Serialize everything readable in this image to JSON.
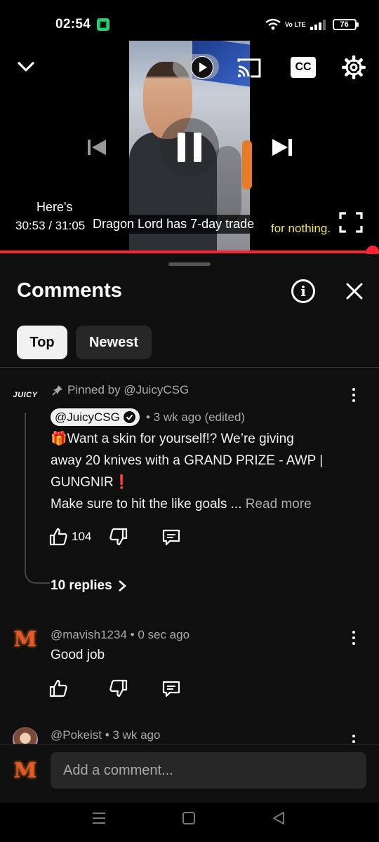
{
  "status_bar": {
    "time": "02:54",
    "app_badge": "▣",
    "network": "Vo LTE",
    "battery": "76"
  },
  "player": {
    "caption_line1": "Here's",
    "time": "30:53 / 31:05",
    "caption_main": "Dragon Lord has 7-day trade",
    "caption_tail": "for nothing.",
    "cc_label": "CC",
    "progress": 0.9935
  },
  "comments_panel": {
    "title": "Comments",
    "info_label": "i",
    "filters": [
      "Top",
      "Newest"
    ],
    "input_placeholder": "Add a comment..."
  },
  "pinned_comment": {
    "avatar_label": "JUICY",
    "pinned_text": "Pinned by @JuicyCSG",
    "author": "@JuicyCSG",
    "meta": "• 3 wk ago (edited)",
    "line1": "🎁Want a skin for yourself!? We’re giving",
    "line2": "away 20 knives with a GRAND PRIZE - AWP |",
    "line3": "GUNGNIR❗",
    "line4": "Make sure to hit the like goals ...",
    "read_more": "Read more",
    "likes": "104",
    "replies": "10 replies"
  },
  "comment2": {
    "avatar_label": "M",
    "author_meta": "@mavish1234 • 0 sec ago",
    "text": "Good job"
  },
  "comment3": {
    "author_meta": "@Pokeist • 3 wk ago"
  },
  "bottom_avatar": "M",
  "colors": {
    "accent": "#ff2233",
    "background": "#0f0f0f",
    "chip_active": "#f1f1f1",
    "caption_yellow": "#f2e35a"
  },
  "icons": [
    "collapse-chevron-icon",
    "autoplay-icon",
    "cast-icon",
    "settings-gear-icon",
    "previous-icon",
    "pause-icon",
    "next-icon",
    "fullscreen-icon",
    "close-icon",
    "pin-icon",
    "verified-check-icon",
    "thumb-up-icon",
    "thumb-down-icon",
    "reply-icon",
    "more-vert-icon",
    "chevron-right-icon",
    "menu-icon",
    "home-square-icon",
    "back-triangle-icon"
  ]
}
